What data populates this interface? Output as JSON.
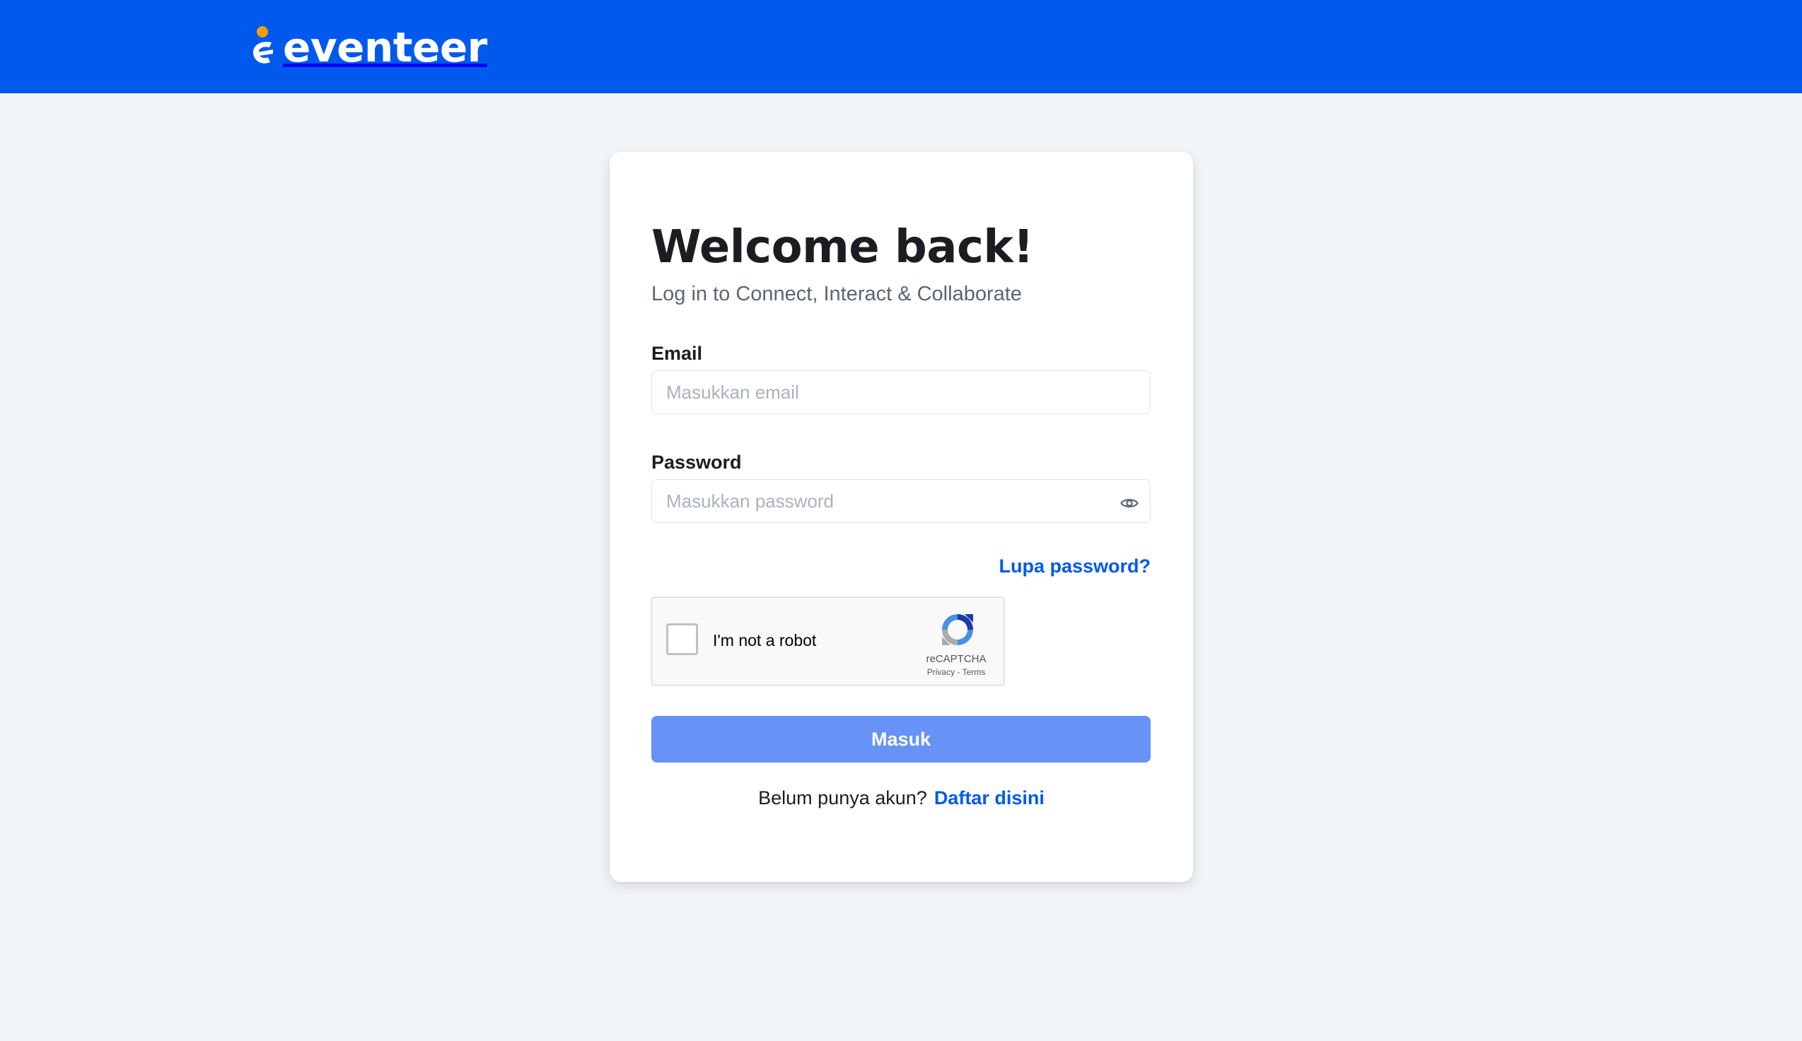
{
  "header": {
    "logo_text": "eventeer",
    "bg_color": "#0059ed"
  },
  "login": {
    "title": "Welcome back!",
    "subtitle": "Log in to Connect, Interact & Collaborate",
    "email_label": "Email",
    "email_placeholder": "Masukkan email",
    "email_value": "",
    "password_label": "Password",
    "password_placeholder": "Masukkan password",
    "password_value": "",
    "password_toggle_icon": "eye-icon",
    "forgot_link": "Lupa password?",
    "submit_label": "Masuk",
    "signup_prompt": "Belum punya akun?",
    "signup_link": "Daftar disini",
    "accent_color": "#0059ed",
    "button_color": "#6693f5"
  },
  "recaptcha": {
    "label": "I'm not a robot",
    "checked": false,
    "brand": "reCAPTCHA",
    "privacy_link": "Privacy",
    "separator": " - ",
    "terms_link": "Terms"
  }
}
